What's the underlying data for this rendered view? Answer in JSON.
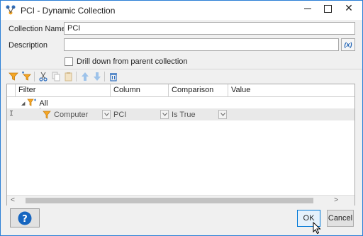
{
  "window": {
    "title": "PCI - Dynamic Collection",
    "controls": {
      "minimize": "—",
      "maximize": "☐",
      "close": "✕"
    }
  },
  "form": {
    "collection_name_label": "Collection Name",
    "collection_name_value": "PCI",
    "description_label": "Description",
    "description_value": "",
    "variable_button": "(x)",
    "drill_down_label": "Drill down from parent collection",
    "drill_down_checked": false
  },
  "toolbar": {
    "icons": [
      "add-filter-icon",
      "add-child-filter-icon",
      "cut-icon",
      "copy-icon",
      "paste-icon",
      "move-up-icon",
      "move-down-icon",
      "delete-icon"
    ]
  },
  "grid": {
    "columns": [
      "Filter",
      "Column",
      "Comparison",
      "Value"
    ],
    "root_label": "All",
    "row": {
      "marker": "I",
      "filter": "Computer",
      "column": "PCI",
      "comparison": "Is True",
      "value": ""
    },
    "scroll_left": "<",
    "scroll_right": ">"
  },
  "buttons": {
    "help": "?",
    "ok": "OK",
    "cancel": "Cancel"
  },
  "colors": {
    "accent": "#0078d7",
    "filter_icon": "#f5a623",
    "help_icon": "#1565c0",
    "window_border": "#2b7fd6"
  }
}
